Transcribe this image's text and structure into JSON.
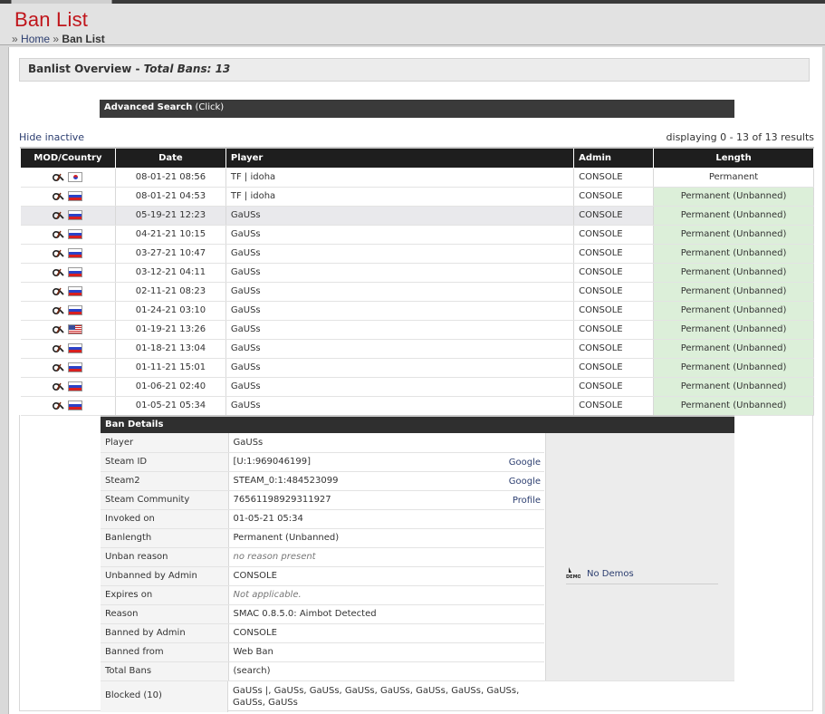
{
  "header": {
    "title": "Ban List",
    "breadcrumb_sep": "»",
    "breadcrumb_home": "Home",
    "breadcrumb_current": "Ban List"
  },
  "overview": {
    "title": "Banlist Overview",
    "dash": " - ",
    "total": "Total Bans: 13"
  },
  "advanced_search": {
    "label": "Advanced Search",
    "hint": "(Click)"
  },
  "hide_inactive": "Hide inactive",
  "displaying": "displaying 0 - 13 of 13 results",
  "table": {
    "headers": [
      "MOD/Country",
      "Date",
      "Player",
      "Admin",
      "Length"
    ],
    "rows": [
      {
        "flag": "kr",
        "date": "08-01-21 08:56",
        "player": "TF | idoha",
        "admin": "CONSOLE",
        "length": "Permanent",
        "unbanned": false
      },
      {
        "flag": "ru",
        "date": "08-01-21 04:53",
        "player": "TF | idoha",
        "admin": "CONSOLE",
        "length": "Permanent (Unbanned)",
        "unbanned": true
      },
      {
        "flag": "ru",
        "date": "05-19-21 12:23",
        "player": "GaUSs",
        "admin": "CONSOLE",
        "length": "Permanent (Unbanned)",
        "unbanned": true
      },
      {
        "flag": "ru",
        "date": "04-21-21 10:15",
        "player": "GaUSs",
        "admin": "CONSOLE",
        "length": "Permanent (Unbanned)",
        "unbanned": true
      },
      {
        "flag": "ru",
        "date": "03-27-21 10:47",
        "player": "GaUSs",
        "admin": "CONSOLE",
        "length": "Permanent (Unbanned)",
        "unbanned": true
      },
      {
        "flag": "ru",
        "date": "03-12-21 04:11",
        "player": "GaUSs",
        "admin": "CONSOLE",
        "length": "Permanent (Unbanned)",
        "unbanned": true
      },
      {
        "flag": "ru",
        "date": "02-11-21 08:23",
        "player": "GaUSs",
        "admin": "CONSOLE",
        "length": "Permanent (Unbanned)",
        "unbanned": true
      },
      {
        "flag": "ru",
        "date": "01-24-21 03:10",
        "player": "GaUSs",
        "admin": "CONSOLE",
        "length": "Permanent (Unbanned)",
        "unbanned": true
      },
      {
        "flag": "us",
        "date": "01-19-21 13:26",
        "player": "GaUSs",
        "admin": "CONSOLE",
        "length": "Permanent (Unbanned)",
        "unbanned": true
      },
      {
        "flag": "ru",
        "date": "01-18-21 13:04",
        "player": "GaUSs",
        "admin": "CONSOLE",
        "length": "Permanent (Unbanned)",
        "unbanned": true
      },
      {
        "flag": "ru",
        "date": "01-11-21 15:01",
        "player": "GaUSs",
        "admin": "CONSOLE",
        "length": "Permanent (Unbanned)",
        "unbanned": true
      },
      {
        "flag": "ru",
        "date": "01-06-21 02:40",
        "player": "GaUSs",
        "admin": "CONSOLE",
        "length": "Permanent (Unbanned)",
        "unbanned": true
      },
      {
        "flag": "ru",
        "date": "01-05-21 05:34",
        "player": "GaUSs",
        "admin": "CONSOLE",
        "length": "Permanent (Unbanned)",
        "unbanned": true
      }
    ]
  },
  "details": {
    "title": "Ban Details",
    "rows": [
      {
        "label": "Player",
        "value": "GaUSs",
        "link": "",
        "muted": false
      },
      {
        "label": "Steam ID",
        "value": "[U:1:969046199]",
        "link": "Google",
        "muted": false
      },
      {
        "label": "Steam2",
        "value": "STEAM_0:1:484523099",
        "link": "Google",
        "muted": false
      },
      {
        "label": "Steam Community",
        "value": "76561198929311927",
        "link": "Profile",
        "muted": false
      },
      {
        "label": "Invoked on",
        "value": "01-05-21 05:34",
        "link": "",
        "muted": false
      },
      {
        "label": "Banlength",
        "value": "Permanent (Unbanned)",
        "link": "",
        "muted": false
      },
      {
        "label": "Unban reason",
        "value": "no reason present",
        "link": "",
        "muted": true
      },
      {
        "label": "Unbanned by Admin",
        "value": "CONSOLE",
        "link": "",
        "muted": false
      },
      {
        "label": "Expires on",
        "value": "Not applicable.",
        "link": "",
        "muted": true
      },
      {
        "label": "Reason",
        "value": "SMAC 0.8.5.0: Aimbot Detected",
        "link": "",
        "muted": false
      },
      {
        "label": "Banned by Admin",
        "value": "CONSOLE",
        "link": "",
        "muted": false
      },
      {
        "label": "Banned from",
        "value": "Web Ban",
        "link": "",
        "muted": false
      },
      {
        "label": "Total Bans",
        "value": "(search)",
        "link": "",
        "muted": false
      }
    ],
    "blocked_label": "Blocked (10)",
    "blocked_value": "GaUSs |, GaUSs, GaUSs, GaUSs, GaUSs, GaUSs, GaUSs, GaUSs, GaUSs, GaUSs",
    "demo_icon": "DEMO",
    "demo_label": "No Demos"
  }
}
